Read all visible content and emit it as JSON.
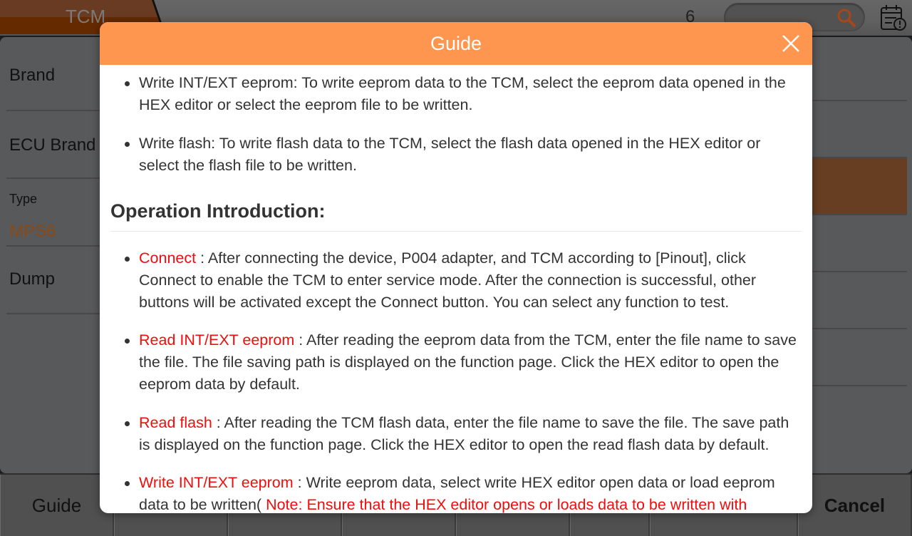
{
  "topbar": {
    "tab_label": "TCM",
    "page_number": "6",
    "search_placeholder": "",
    "icons": {
      "search": "search-icon",
      "calendar": "calendar-alert-icon"
    },
    "accent_color": "#ff9650"
  },
  "left_panel": {
    "brand_label": "Brand",
    "ecu_brand_label": "ECU Brand",
    "type_label": "Type",
    "type_value": "MPS6",
    "dump_label": "Dump"
  },
  "bottombar": {
    "buttons": [
      "Guide",
      "",
      "",
      "",
      "",
      "",
      "",
      "Cancel"
    ]
  },
  "dialog": {
    "title": "Guide",
    "close_icon": "close-icon",
    "items_top": [
      {
        "text": "Write INT/EXT eeprom: To write eeprom data to the TCM, select the eeprom data opened in the HEX editor or select the eeprom file to be written."
      },
      {
        "text": "Write flash: To write flash data to the TCM, select the flash data opened in the HEX editor or select the flash file to be written."
      }
    ],
    "heading": "Operation Introduction:",
    "items": [
      {
        "term": "Connect",
        "text": " : After connecting the device, P004 adapter, and TCM according to [Pinout], click Connect to enable the TCM to enter service mode. After the connection is successful, other buttons will be activated except the Connect button. You can select any function to test."
      },
      {
        "term": "Read INT/EXT eeprom",
        "text": " : After reading the eeprom data from the TCM, enter the file name to save the file. The file saving path is displayed on the function page. Click the HEX editor to open the eeprom data by default."
      },
      {
        "term": "Read flash",
        "text": " : After reading the TCM flash data, enter the file name to save the file. The save path is displayed on the function page. Click the HEX editor to open the read flash data by default."
      },
      {
        "term": "Write INT/EXT eeprom",
        "text": " : Write eeprom data, select write HEX editor open data or load eeprom data to be written( ",
        "note": "Note: Ensure that the HEX editor opens or loads data to be written with integrity"
      }
    ]
  }
}
